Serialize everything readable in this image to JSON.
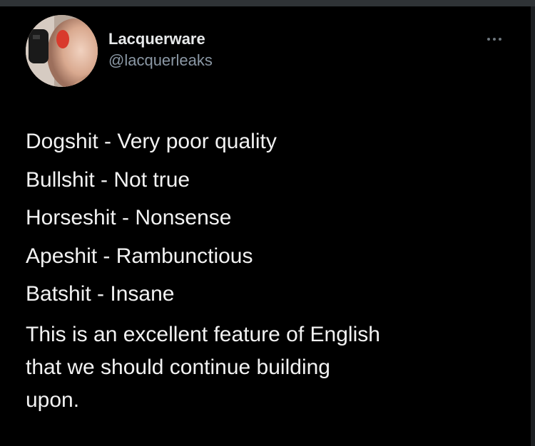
{
  "tweet": {
    "author": {
      "display_name": "Lacquerware",
      "handle": "@lacquerleaks",
      "avatar_icon": "profile-photo"
    },
    "more_icon": "more-options-icon",
    "definitions": [
      "Dogshit - Very poor quality",
      "Bullshit - Not true",
      "Horseshit - Nonsense",
      "Apeshit - Rambunctious",
      "Batshit - Insane"
    ],
    "closing": [
      "This is an excellent feature of English",
      "that we should continue building",
      "upon."
    ]
  },
  "colors": {
    "background": "#000000",
    "primary_text": "#e7e9ea",
    "secondary_text": "#8b98a5",
    "top_bar": "#2f3336"
  }
}
